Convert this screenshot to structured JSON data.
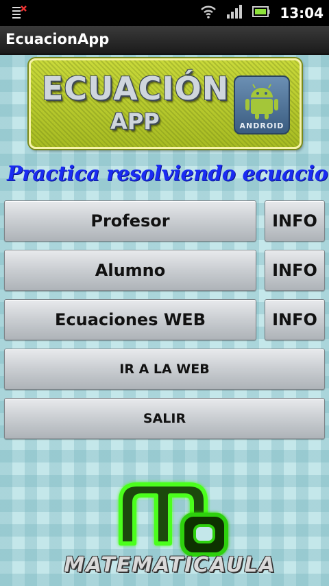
{
  "status_bar": {
    "time": "13:04",
    "icons": [
      "notification-icon",
      "wifi-icon",
      "signal-icon",
      "battery-icon"
    ]
  },
  "app": {
    "title": "EcuacionApp"
  },
  "banner": {
    "title": "ECUACIÓN",
    "subtitle": "APP",
    "badge_label": "ANDROID"
  },
  "tagline": "Practica resolviendo ecuaciones",
  "menu": {
    "rows": [
      {
        "label": "Profesor",
        "info": "INFO"
      },
      {
        "label": "Alumno",
        "info": "INFO"
      },
      {
        "label": "Ecuaciones WEB",
        "info": "INFO"
      }
    ],
    "web_button": "IR A LA WEB",
    "exit_button": "SALIR"
  },
  "footer_logo": {
    "text": "MATEMATICAULA"
  },
  "colors": {
    "background": "#c4e7ea",
    "banner": "#b6c92c",
    "tagline": "#1a2cf2",
    "logo_green": "#4cff1a"
  }
}
